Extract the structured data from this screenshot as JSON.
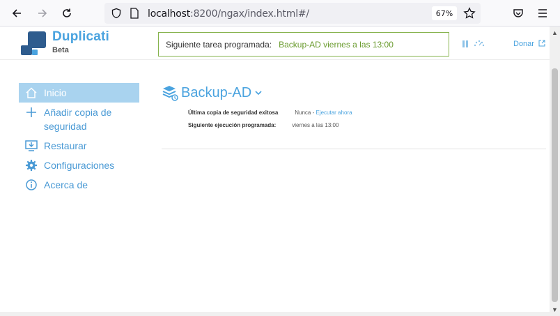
{
  "browser": {
    "url_host": "localhost",
    "url_rest": ":8200/ngax/index.html#/",
    "zoom": "67%"
  },
  "header": {
    "brand": "Duplicati",
    "brand_sub": "Beta",
    "next_task_label": "Siguiente tarea programada:",
    "next_task_value": "Backup-AD viernes a las 13:00",
    "donate": "Donar"
  },
  "sidebar": {
    "items": [
      {
        "label": "Inicio",
        "icon": "home-icon"
      },
      {
        "label": "Añadir copia de seguridad",
        "icon": "plus-icon"
      },
      {
        "label": "Restaurar",
        "icon": "restore-icon"
      },
      {
        "label": "Configuraciones",
        "icon": "gear-icon"
      },
      {
        "label": "Acerca de",
        "icon": "info-icon"
      }
    ]
  },
  "backup": {
    "name": "Backup-AD",
    "last_success_label": "Última copia de seguridad exitosa",
    "last_success_value": "Nunca",
    "run_now": "Ejecutar ahora",
    "next_run_label": "Siguiente ejecución programada:",
    "next_run_value": "viernes a las 13:00"
  },
  "colors": {
    "accent": "#4aa3df",
    "active_bg": "#a9d3ef",
    "task_border": "#86b34d",
    "task_text": "#6a9b2e"
  }
}
